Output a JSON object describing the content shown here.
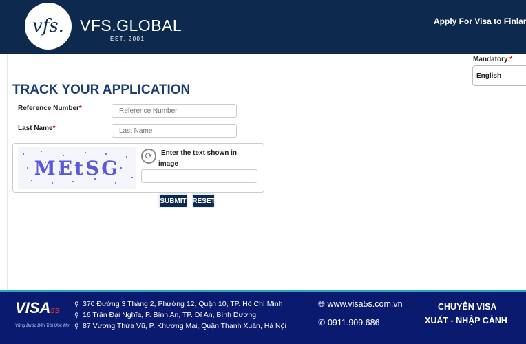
{
  "header": {
    "logo_text": "vfs.",
    "brand": "VFS.GLOBAL",
    "est": "EST. 2001",
    "apply_text": "Apply For Visa to Finland"
  },
  "language": {
    "mandatory_label": "Mandatory",
    "mandatory_star": "*",
    "selected": "English"
  },
  "form": {
    "title": "TRACK YOUR APPLICATION",
    "ref_label": "Reference Number",
    "ref_placeholder": "Reference Number",
    "last_label": "Last Name",
    "last_placeholder": "Last Name",
    "required_star": "*",
    "captcha_prompt_line1": "Enter the text shown in",
    "captcha_prompt_line2": "image",
    "captcha_code": "MEtSG",
    "submit": "SUBMIT",
    "reset": "RESET"
  },
  "footer": {
    "logo": "VISA",
    "logo_sup": "5S",
    "logo_slogan": "Vững Bước Đến Trời Ước Mơ",
    "addresses": [
      "370 Đường 3 Tháng 2, Phường 12, Quận 10, TP. Hồ Chí Minh",
      "16 Trần Đại Nghĩa, P. Bình An, TP. Dĩ An, Bình Dương",
      "87 Vương Thừa Vũ, P. Khương Mai, Quận Thanh Xuân, Hà Nội"
    ],
    "website": "www.visa5s.com.vn",
    "phone": "0911.909.686",
    "slogan_line1": "CHUYÊN VISA",
    "slogan_line2": "XUẤT - NHẬP CẢNH"
  }
}
